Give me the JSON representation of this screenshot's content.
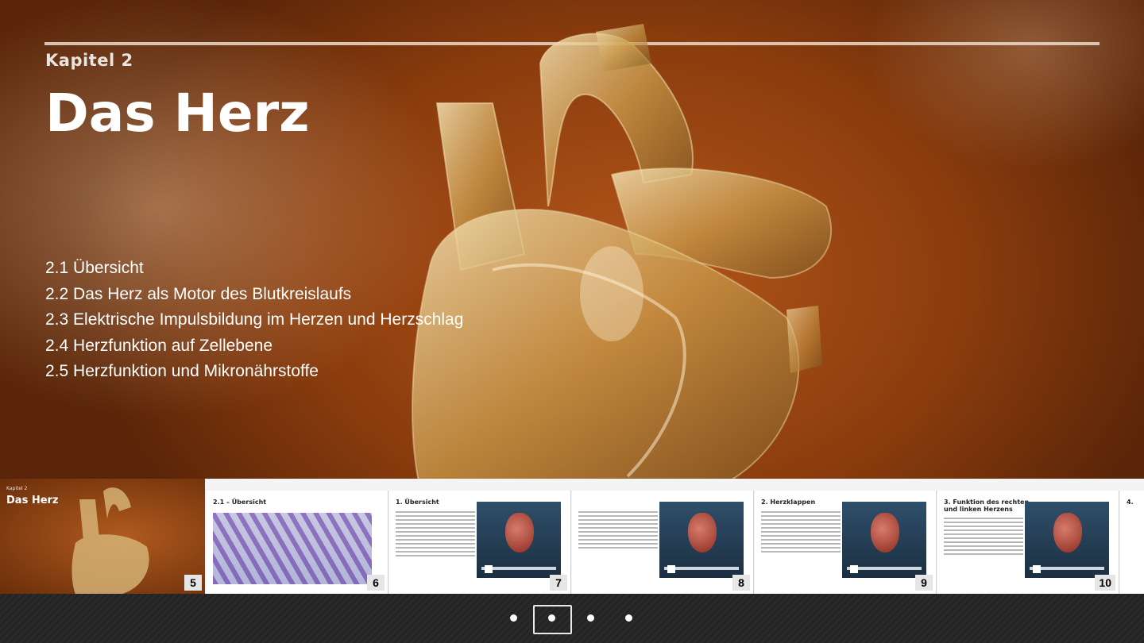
{
  "slide": {
    "chapter_label": "Kapitel 2",
    "title": "Das Herz",
    "toc": [
      "2.1 Übersicht",
      "2.2 Das Herz als Motor des Blutkreislaufs",
      "2.3 Elektrische Impulsbildung im Herzen und Herzschlag",
      "2.4 Herzfunktion auf Zellebene",
      "2.5 Herzfunktion und Mikronährstoffe"
    ]
  },
  "thumbnails": [
    {
      "page": "5",
      "label": "Kapitel 2",
      "title": "Das Herz",
      "active": true
    },
    {
      "page": "6",
      "title": "2.1 – Übersicht"
    },
    {
      "page": "7",
      "title": "1. Übersicht"
    },
    {
      "page": "8",
      "title": ""
    },
    {
      "page": "9",
      "title": "2. Herzklappen"
    },
    {
      "page": "10",
      "title": "3. Funktion des rechten und linken Herzens"
    },
    {
      "page": "",
      "title": "4."
    }
  ],
  "pager": {
    "dots": 4,
    "current_index": 1
  },
  "colors": {
    "background_brown": "#8a3c0d",
    "strip": "#f4f4f4",
    "pager_bar": "#262626"
  }
}
